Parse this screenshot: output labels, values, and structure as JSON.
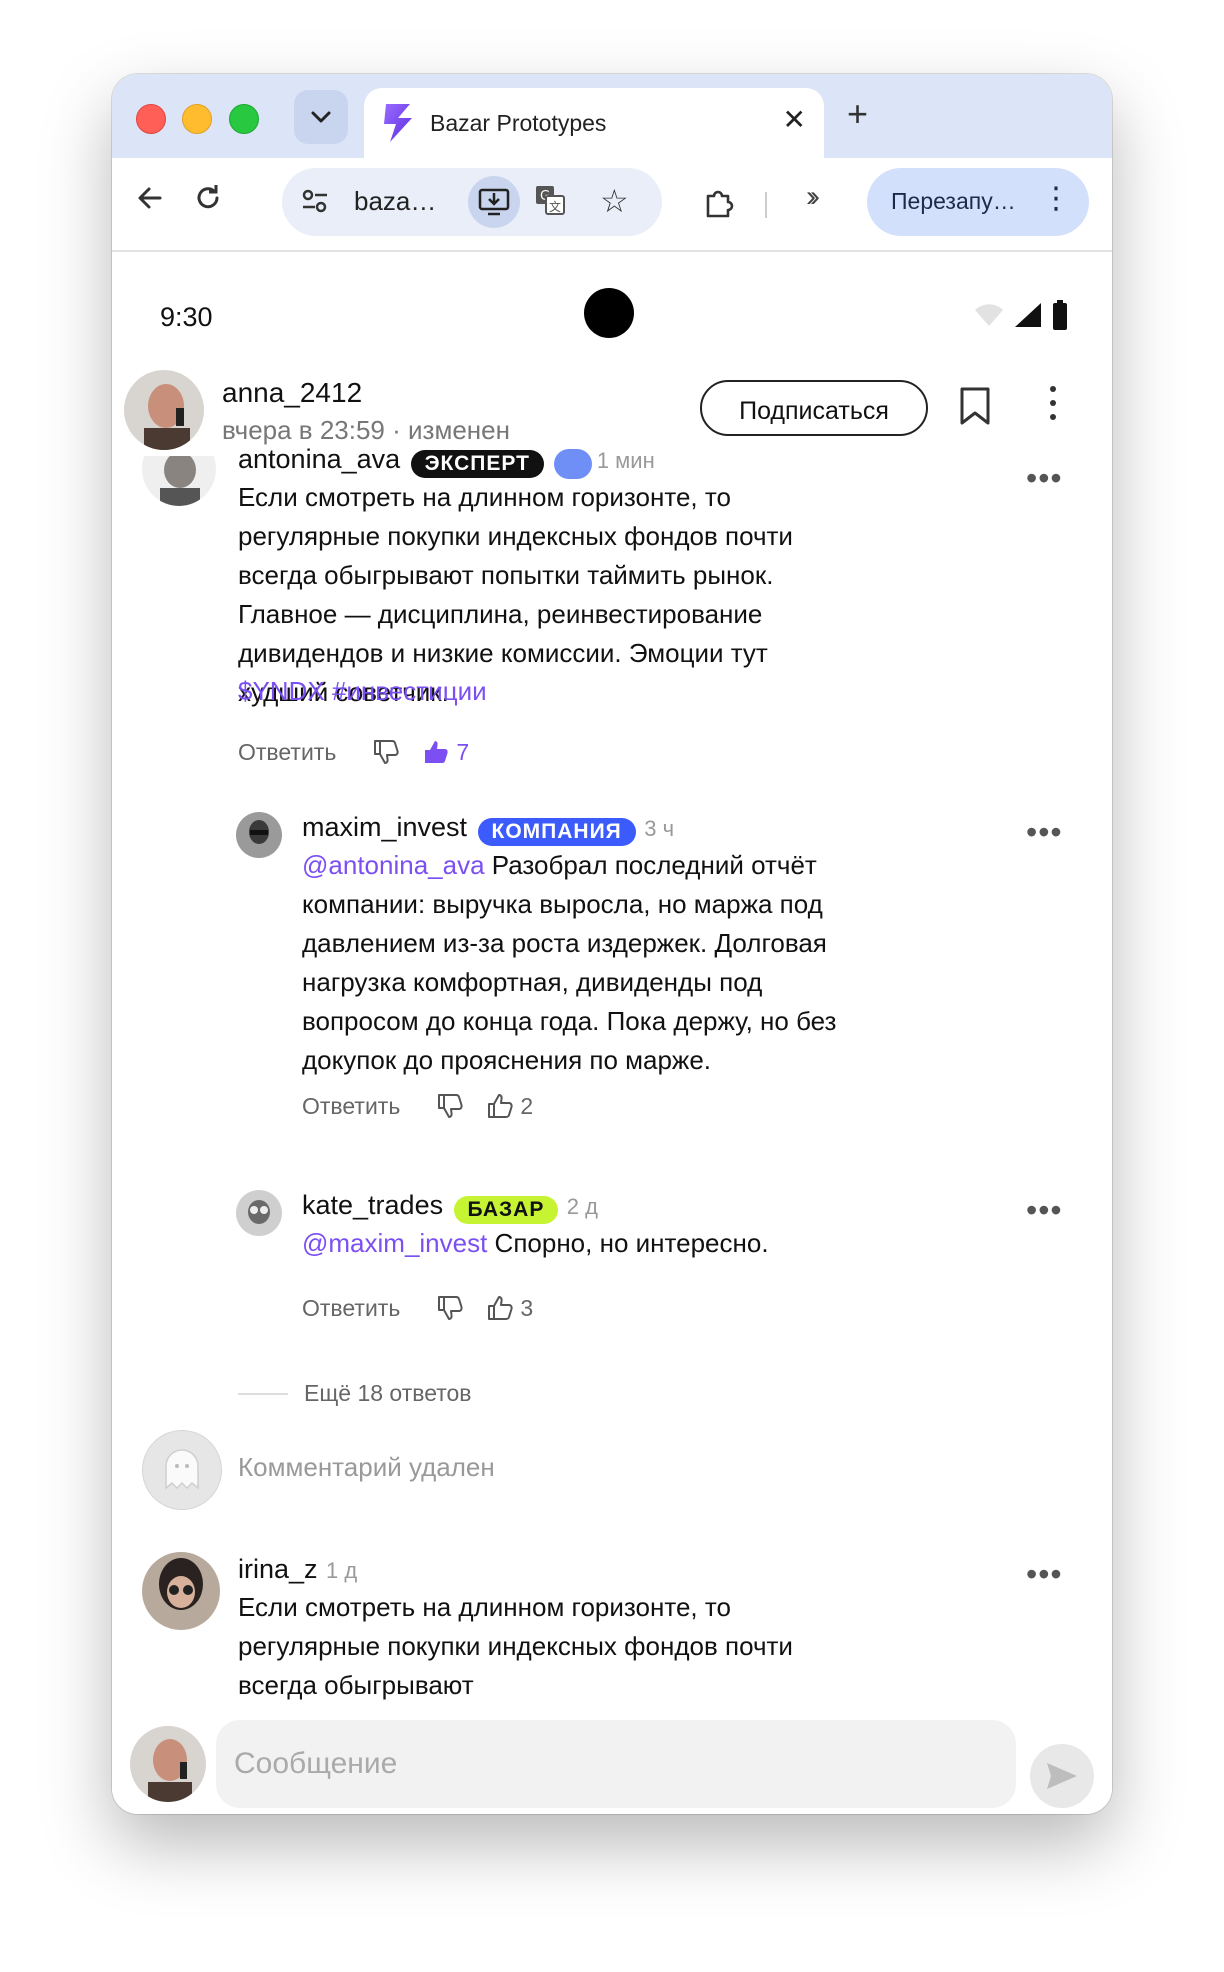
{
  "browser": {
    "tab_title": "Bazar Prototypes",
    "url": "baza…",
    "relaunch_label": "Перезапу…"
  },
  "status_bar": {
    "time": "9:30"
  },
  "post_header": {
    "author": "anna_2412",
    "meta": "вчера в 23:59 · изменен",
    "subscribe_label": "Подписаться"
  },
  "comments": {
    "c1": {
      "author": "antonina_ava",
      "badge": "ЭКСПЕРТ",
      "time": "1 мин",
      "text": "Если смотреть на длинном горизонте, то регулярные покупки индексных фондов почти всегда обыгрывают попытки таймить рынок. Главное — дисциплина, реинвестирование дивидендов и низкие комиссии. Эмоции тут худший советчик.",
      "tag1": "$YNDX",
      "tag2": "#инвестиции",
      "reply_label": "Ответить",
      "likes": "7"
    },
    "c2": {
      "author": "maxim_invest",
      "badge": "КОМПАНИЯ",
      "time": "3 ч",
      "mention": "@antonina_ava",
      "text": " Разобрал последний отчёт компании: выручка выросла, но маржа под давлением из-за роста издержек. Долговая нагрузка комфортная, дивиденды под вопросом до конца года. Пока держу, но без докупок до прояснения по марже.",
      "reply_label": "Ответить",
      "likes": "2"
    },
    "c3": {
      "author": "kate_trades",
      "badge": "БАЗАР",
      "time": "2 д",
      "mention": "@maxim_invest",
      "text": " Спорно, но интересно.",
      "reply_label": "Ответить",
      "likes": "3"
    },
    "more_replies": "Ещё 18 ответов",
    "deleted": "Комментарий удален",
    "c4": {
      "author": "irina_z",
      "time": "1 д",
      "text": "Если смотреть на длинном горизонте, то регулярные покупки индексных фондов почти всегда обыгрывают"
    }
  },
  "composer": {
    "placeholder": "Сообщение"
  },
  "colors": {
    "accent_purple": "#7b4ff2",
    "badge_expert_bg": "#111111",
    "badge_company_bg": "#3b5bfd",
    "badge_bazar_bg": "#c6f432"
  }
}
